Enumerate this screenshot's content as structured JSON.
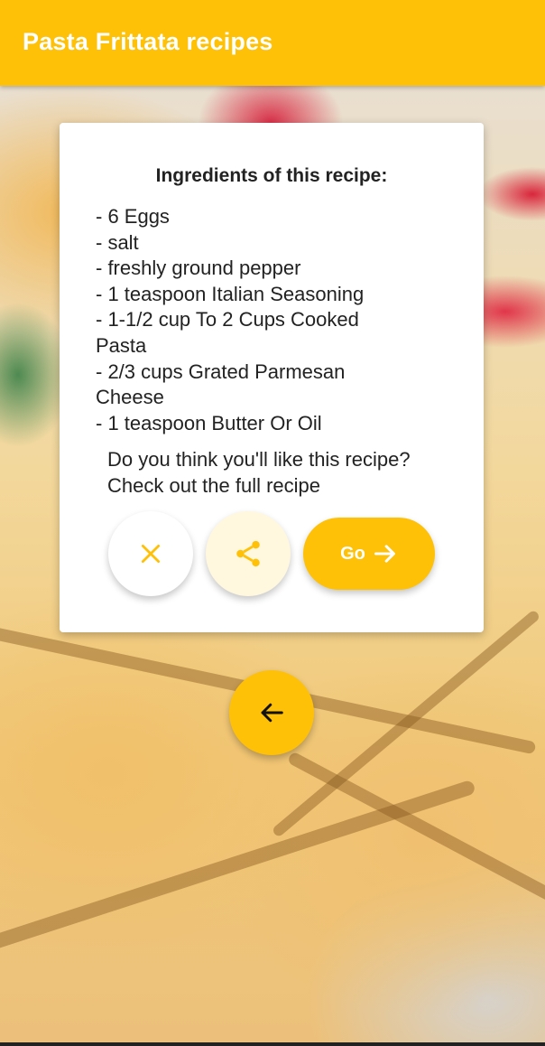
{
  "app_bar": {
    "title": "Pasta Frittata recipes"
  },
  "dialog": {
    "heading": "Ingredients of this recipe:",
    "ingredients": [
      " - 6 Eggs",
      " - salt",
      " - freshly ground pepper",
      " - 1 teaspoon Italian Seasoning",
      " - 1-1/2 cup To 2 Cups Cooked Pasta",
      " - 2/3 cups Grated Parmesan Cheese",
      " - 1 teaspoon Butter Or Oil"
    ],
    "question": "Do you think you'll like this recipe? Check out the full recipe",
    "buttons": {
      "close_icon": "close-icon",
      "share_icon": "share-icon",
      "go_label": "Go",
      "go_icon": "arrow-right-icon"
    }
  },
  "back_button": {
    "icon": "arrow-left-icon"
  },
  "colors": {
    "accent": "#fec107",
    "share_bg": "#fff7de",
    "text": "#222222"
  }
}
